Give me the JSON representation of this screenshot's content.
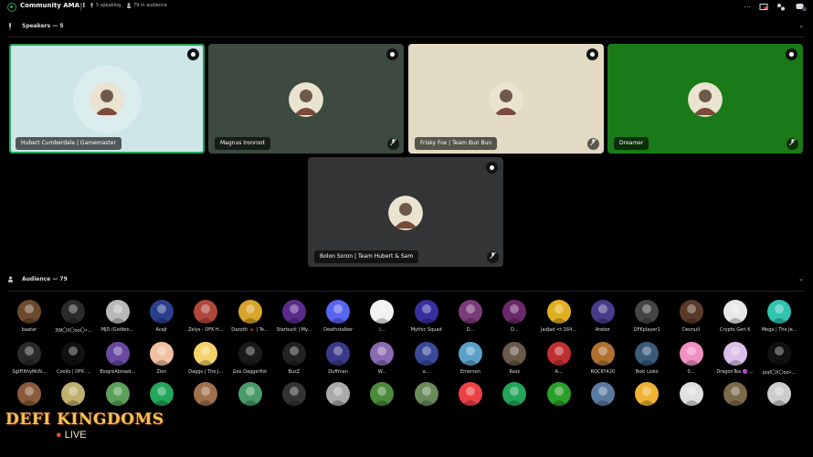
{
  "header": {
    "title": "Community AMA!!",
    "speaking": "5 speaking",
    "audience_count": "79 in audience"
  },
  "speakers_section": {
    "label": "Speakers — 5"
  },
  "audience_section": {
    "label": "Audience — 79"
  },
  "speakers": [
    {
      "name": "Hubert Cumberdale | Gamemaster",
      "bg": "#cfe6e8",
      "active": true,
      "muted": false
    },
    {
      "name": "Magnus Ironroot",
      "bg": "#3c4a40",
      "active": false,
      "muted": true
    },
    {
      "name": "Frisky Fox | Team Bun Bun",
      "bg": "#e2dac3",
      "active": false,
      "muted": true
    },
    {
      "name": "Dreamer",
      "bg": "#1a7a17",
      "active": false,
      "muted": true
    },
    {
      "name": "Bolon Soron | Team Hubert & Sam",
      "bg": "#333436",
      "active": false,
      "muted": true
    }
  ],
  "audience_rows": [
    [
      {
        "name": "baatar",
        "c": "#6b4a2e"
      },
      {
        "name": "3W〇X〇oo〇•...",
        "c": "#2a2a2a"
      },
      {
        "name": "MJD (Golden...",
        "c": "#b9b9b9"
      },
      {
        "name": "AceJr",
        "c": "#2a3f8c"
      },
      {
        "name": "Zelys - DFK H...",
        "c": "#b0473b"
      },
      {
        "name": "Dazoth 🔺 | Te...",
        "c": "#d8a42a"
      },
      {
        "name": "Starbuck | My...",
        "c": "#5a2a8c"
      },
      {
        "name": "Deathstalker",
        "c": "#5865f2"
      },
      {
        "name": "i...",
        "c": "#f2f2f2"
      },
      {
        "name": "Mythic Squad",
        "c": "#3a2fa0"
      },
      {
        "name": "D...",
        "c": "#7a3b7a"
      },
      {
        "name": "D...",
        "c": "#6a2a6a"
      },
      {
        "name": "Jadjad <t:164...",
        "c": "#e0b020"
      },
      {
        "name": "Arekor",
        "c": "#4a3a8c"
      },
      {
        "name": "DFKplayer1",
        "c": "#444"
      },
      {
        "name": "Devnull",
        "c": "#5a3a2a"
      },
      {
        "name": "Crypto Geri K",
        "c": "#e8e8e8"
      },
      {
        "name": "Mega | The Je...",
        "c": "#2fc4b0"
      }
    ],
    [
      {
        "name": "SgtFilthyMcN...",
        "c": "#2a2a2a"
      },
      {
        "name": "Coolio | DFK ...",
        "c": "#111"
      },
      {
        "name": "BiogreAbroad...",
        "c": "#6a4aa0"
      },
      {
        "name": "Zion",
        "c": "#f0c0a0"
      },
      {
        "name": "Daggs | The J...",
        "c": "#f5d36a"
      },
      {
        "name": "Gox Daggerfist",
        "c": "#1a1a1a"
      },
      {
        "name": "BuzZ",
        "c": "#222"
      },
      {
        "name": "Duffman",
        "c": "#3a3a8a"
      },
      {
        "name": "W...",
        "c": "#8a6ab0"
      },
      {
        "name": "a...",
        "c": "#3a4a9a"
      },
      {
        "name": "Emerson",
        "c": "#5aa0c8"
      },
      {
        "name": "Razz",
        "c": "#6a5a4a"
      },
      {
        "name": "A...",
        "c": "#c03030"
      },
      {
        "name": "ROCKY420",
        "c": "#b07030"
      },
      {
        "name": "Boki Lisko",
        "c": "#3a5a7a"
      },
      {
        "name": "0...",
        "c": "#f090c0"
      },
      {
        "name": "DragonTea 🟣 ...",
        "c": "#d8c0e8"
      },
      {
        "name": "piaf〇X〇oo•...",
        "c": "#111"
      }
    ],
    [
      {
        "name": "",
        "c": "#8a5a3a"
      },
      {
        "name": "",
        "c": "#c0b070"
      },
      {
        "name": "",
        "c": "#5aa05a"
      },
      {
        "name": "",
        "c": "#23a55a"
      },
      {
        "name": "",
        "c": "#a0704a"
      },
      {
        "name": "",
        "c": "#4a9a6a"
      },
      {
        "name": "",
        "c": "#333"
      },
      {
        "name": "",
        "c": "#aaa"
      },
      {
        "name": "",
        "c": "#4a8a3a"
      },
      {
        "name": "",
        "c": "#6a8a5a"
      },
      {
        "name": "",
        "c": "#ed4245"
      },
      {
        "name": "",
        "c": "#23a55a"
      },
      {
        "name": "",
        "c": "#2aa02a"
      },
      {
        "name": "",
        "c": "#5a7aa0"
      },
      {
        "name": "",
        "c": "#f0b232"
      },
      {
        "name": "",
        "c": "#e0e0e0"
      },
      {
        "name": "",
        "c": "#7a6a4a"
      },
      {
        "name": "",
        "c": "#ccc"
      }
    ]
  ],
  "logo": {
    "line1": "DEFI KINGDOMS",
    "line2": "LIVE"
  }
}
